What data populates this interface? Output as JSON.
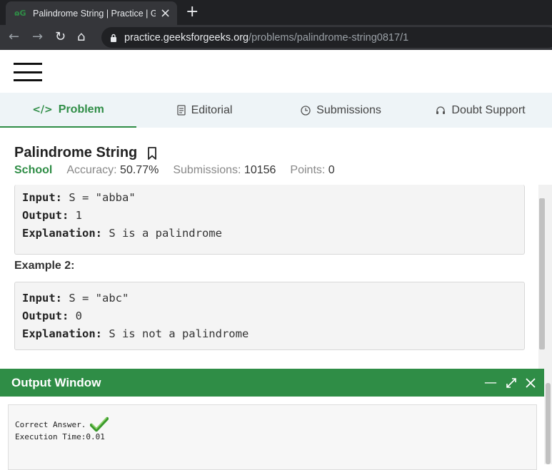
{
  "browser": {
    "tab_title": "Palindrome String | Practice | Gee",
    "favicon_text": "ɷG",
    "url_host": "practice.geeksforgeeks.org",
    "url_path": "/problems/palindrome-string0817/1"
  },
  "tabs": [
    {
      "label": "Problem",
      "icon": "code-icon"
    },
    {
      "label": "Editorial",
      "icon": "document-icon"
    },
    {
      "label": "Submissions",
      "icon": "clock-icon"
    },
    {
      "label": "Doubt Support",
      "icon": "headset-icon"
    }
  ],
  "problem": {
    "title": "Palindrome String",
    "difficulty": "School",
    "accuracy_label": "Accuracy:",
    "accuracy_value": "50.77%",
    "submissions_label": "Submissions:",
    "submissions_value": "10156",
    "points_label": "Points:",
    "points_value": "0"
  },
  "example1": {
    "input_label": "Input:",
    "input_value": " S = \"abba\"",
    "output_label": "Output:",
    "output_value": " 1",
    "explanation_label": "Explanation:",
    "explanation_value": " S is a palindrome"
  },
  "example2": {
    "heading": "Example 2:",
    "input_label": "Input:",
    "input_value": " S = \"abc\"",
    "output_label": "Output:",
    "output_value": " 0",
    "explanation_label": "Explanation:",
    "explanation_value": " S is not a palindrome"
  },
  "output_window": {
    "title": "Output Window",
    "result": "Correct Answer.",
    "execution_time": "Execution Time:0.01"
  },
  "colors": {
    "accent": "#2f8d46",
    "chrome_dark": "#202124",
    "chrome_toolbar": "#35363a"
  }
}
